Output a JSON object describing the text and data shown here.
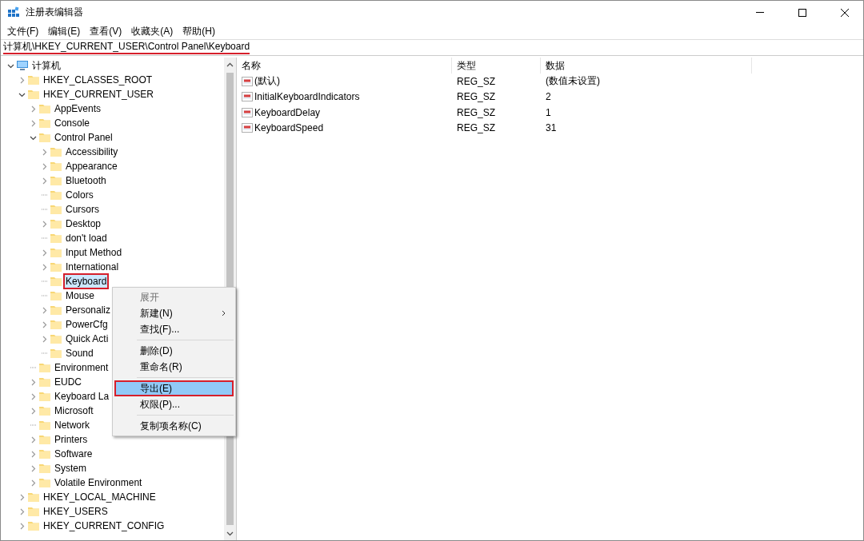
{
  "window": {
    "title": "注册表编辑器"
  },
  "menu_bar": [
    "文件(F)",
    "编辑(E)",
    "查看(V)",
    "收藏夹(A)",
    "帮助(H)"
  ],
  "address_bar": {
    "value": "计算机\\HKEY_CURRENT_USER\\Control Panel\\Keyboard",
    "annotated": true
  },
  "tree": [
    {
      "label": "计算机",
      "kind": "open",
      "selected": false,
      "annotated": false,
      "children": [
        {
          "label": "HKEY_CLASSES_ROOT",
          "kind": "closed",
          "selected": false,
          "annotated": false
        },
        {
          "label": "HKEY_CURRENT_USER",
          "kind": "open",
          "selected": false,
          "annotated": false,
          "children": [
            {
              "label": "AppEvents",
              "kind": "closed",
              "selected": false,
              "annotated": false
            },
            {
              "label": "Console",
              "kind": "closed",
              "selected": false,
              "annotated": false
            },
            {
              "label": "Control Panel",
              "kind": "open",
              "selected": false,
              "annotated": false,
              "children": [
                {
                  "label": "Accessibility",
                  "kind": "closed",
                  "selected": false,
                  "annotated": false
                },
                {
                  "label": "Appearance",
                  "kind": "closed",
                  "selected": false,
                  "annotated": false
                },
                {
                  "label": "Bluetooth",
                  "kind": "closed",
                  "selected": false,
                  "annotated": false
                },
                {
                  "label": "Colors",
                  "kind": "leaf",
                  "selected": false,
                  "annotated": false
                },
                {
                  "label": "Cursors",
                  "kind": "leaf",
                  "selected": false,
                  "annotated": false
                },
                {
                  "label": "Desktop",
                  "kind": "closed",
                  "selected": false,
                  "annotated": false
                },
                {
                  "label": "don't load",
                  "kind": "leaf",
                  "selected": false,
                  "annotated": false
                },
                {
                  "label": "Input Method",
                  "kind": "closed",
                  "selected": false,
                  "annotated": false
                },
                {
                  "label": "International",
                  "kind": "closed",
                  "selected": false,
                  "annotated": false
                },
                {
                  "label": "Keyboard",
                  "kind": "leaf",
                  "selected": true,
                  "annotated": true
                },
                {
                  "label": "Mouse",
                  "kind": "leaf",
                  "selected": false,
                  "annotated": false
                },
                {
                  "label": "Personaliz",
                  "kind": "closed",
                  "selected": false,
                  "annotated": false
                },
                {
                  "label": "PowerCfg",
                  "kind": "closed",
                  "selected": false,
                  "annotated": false
                },
                {
                  "label": "Quick Acti",
                  "kind": "closed",
                  "selected": false,
                  "annotated": false
                },
                {
                  "label": "Sound",
                  "kind": "leaf",
                  "selected": false,
                  "annotated": false
                }
              ]
            },
            {
              "label": "Environment",
              "kind": "leaf",
              "selected": false,
              "annotated": false
            },
            {
              "label": "EUDC",
              "kind": "closed",
              "selected": false,
              "annotated": false
            },
            {
              "label": "Keyboard La",
              "kind": "closed",
              "selected": false,
              "annotated": false
            },
            {
              "label": "Microsoft",
              "kind": "closed",
              "selected": false,
              "annotated": false
            },
            {
              "label": "Network",
              "kind": "leaf",
              "selected": false,
              "annotated": false
            },
            {
              "label": "Printers",
              "kind": "closed",
              "selected": false,
              "annotated": false
            },
            {
              "label": "Software",
              "kind": "closed",
              "selected": false,
              "annotated": false
            },
            {
              "label": "System",
              "kind": "closed",
              "selected": false,
              "annotated": false
            },
            {
              "label": "Volatile Environment",
              "kind": "closed",
              "selected": false,
              "annotated": false
            }
          ]
        },
        {
          "label": "HKEY_LOCAL_MACHINE",
          "kind": "closed",
          "selected": false,
          "annotated": false
        },
        {
          "label": "HKEY_USERS",
          "kind": "closed",
          "selected": false,
          "annotated": false
        },
        {
          "label": "HKEY_CURRENT_CONFIG",
          "kind": "closed",
          "selected": false,
          "annotated": false
        }
      ]
    }
  ],
  "table": {
    "columns": [
      "名称",
      "类型",
      "数据"
    ],
    "rows": [
      {
        "name": "(默认)",
        "type": "REG_SZ",
        "data": "(数值未设置)"
      },
      {
        "name": "InitialKeyboardIndicators",
        "type": "REG_SZ",
        "data": "2"
      },
      {
        "name": "KeyboardDelay",
        "type": "REG_SZ",
        "data": "1"
      },
      {
        "name": "KeyboardSpeed",
        "type": "REG_SZ",
        "data": "31"
      }
    ]
  },
  "context_menu": [
    {
      "kind": "item",
      "label": "展开",
      "disabled": true,
      "submenu": false,
      "selected": false,
      "annotated": false
    },
    {
      "kind": "item",
      "label": "新建(N)",
      "disabled": false,
      "submenu": true,
      "selected": false,
      "annotated": false
    },
    {
      "kind": "item",
      "label": "查找(F)...",
      "disabled": false,
      "submenu": false,
      "selected": false,
      "annotated": false
    },
    {
      "kind": "separator"
    },
    {
      "kind": "item",
      "label": "删除(D)",
      "disabled": false,
      "submenu": false,
      "selected": false,
      "annotated": false
    },
    {
      "kind": "item",
      "label": "重命名(R)",
      "disabled": false,
      "submenu": false,
      "selected": false,
      "annotated": false
    },
    {
      "kind": "separator"
    },
    {
      "kind": "item",
      "label": "导出(E)",
      "disabled": false,
      "submenu": false,
      "selected": true,
      "annotated": true
    },
    {
      "kind": "item",
      "label": "权限(P)...",
      "disabled": false,
      "submenu": false,
      "selected": false,
      "annotated": false
    },
    {
      "kind": "separator"
    },
    {
      "kind": "item",
      "label": "复制项名称(C)",
      "disabled": false,
      "submenu": false,
      "selected": false,
      "annotated": false
    }
  ]
}
